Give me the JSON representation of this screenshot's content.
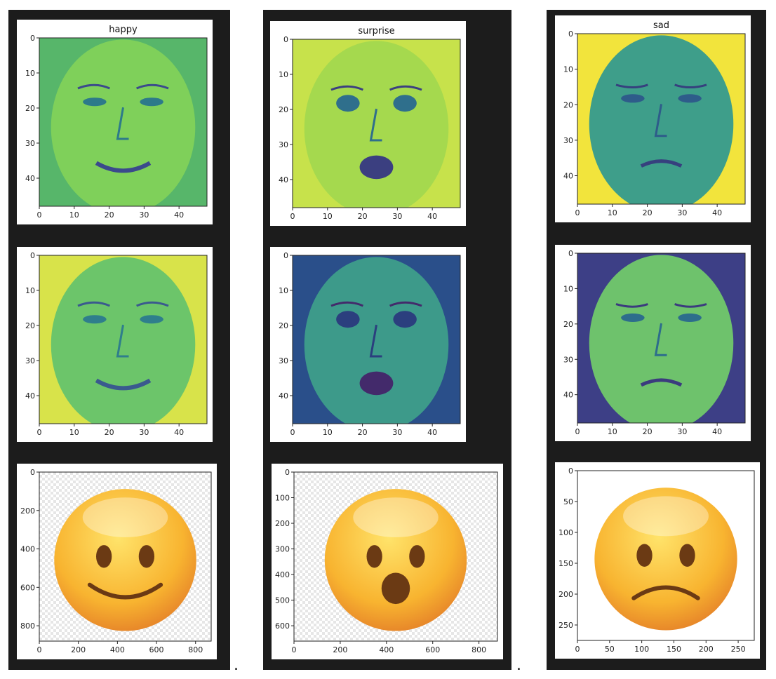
{
  "separator": ".",
  "columns": [
    {
      "name": "happy",
      "title": "happy",
      "faces": [
        {
          "ticks_x": [
            "0",
            "10",
            "20",
            "30",
            "40"
          ],
          "ticks_y": [
            "0",
            "10",
            "20",
            "30",
            "40"
          ]
        },
        {
          "ticks_x": [
            "0",
            "10",
            "20",
            "30",
            "40"
          ],
          "ticks_y": [
            "0",
            "10",
            "20",
            "30",
            "40"
          ]
        }
      ],
      "emoji": {
        "expression": "smile",
        "ticks_x": [
          "0",
          "200",
          "400",
          "600",
          "800"
        ],
        "ticks_y": [
          "0",
          "200",
          "400",
          "600",
          "800"
        ]
      }
    },
    {
      "name": "surprise",
      "title": "surprise",
      "faces": [
        {
          "ticks_x": [
            "0",
            "10",
            "20",
            "30",
            "40"
          ],
          "ticks_y": [
            "0",
            "10",
            "20",
            "30",
            "40"
          ]
        },
        {
          "ticks_x": [
            "0",
            "10",
            "20",
            "30",
            "40"
          ],
          "ticks_y": [
            "0",
            "10",
            "20",
            "30",
            "40"
          ]
        }
      ],
      "emoji": {
        "expression": "surprise",
        "ticks_x": [
          "0",
          "200",
          "400",
          "600",
          "800"
        ],
        "ticks_y": [
          "0",
          "100",
          "200",
          "300",
          "400",
          "500",
          "600"
        ]
      }
    },
    {
      "name": "sad",
      "title": "sad",
      "faces": [
        {
          "ticks_x": [
            "0",
            "10",
            "20",
            "30",
            "40"
          ],
          "ticks_y": [
            "0",
            "10",
            "20",
            "30",
            "40"
          ]
        },
        {
          "ticks_x": [
            "0",
            "10",
            "20",
            "30",
            "40"
          ],
          "ticks_y": [
            "0",
            "10",
            "20",
            "30",
            "40"
          ]
        }
      ],
      "emoji": {
        "expression": "sad",
        "ticks_x": [
          "0",
          "50",
          "100",
          "150",
          "200",
          "250"
        ],
        "ticks_y": [
          "0",
          "50",
          "100",
          "150",
          "200",
          "250"
        ]
      }
    }
  ]
}
